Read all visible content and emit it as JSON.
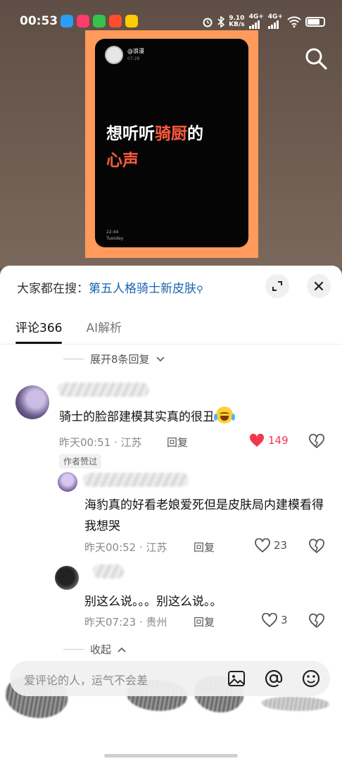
{
  "status_bar": {
    "time": "00:53",
    "net_speed": "9.10",
    "net_unit": "KB/s",
    "sim1": "4G+",
    "sim2": "4G+",
    "app_icon_colors": [
      "#2a9df4",
      "#ff3b6b",
      "#37c24b",
      "#ff4d2e",
      "#ffcc00"
    ]
  },
  "poster": {
    "handle": "@浪漫",
    "time": "07:28",
    "title_line1_a": "想听听",
    "title_line1_b": "骑厨",
    "title_line1_c": "的",
    "title_line2": "心声",
    "clock": "22:44",
    "day": "Tuesday",
    "bg_color": "#ff9a5a",
    "highlight_color": "#ff5a3c"
  },
  "sheet": {
    "hot_search_prefix": "大家都在搜：",
    "hot_search_query": "第五人格骑士新皮肤",
    "tabs": [
      {
        "label": "评论366",
        "active": true
      },
      {
        "label": "AI解析",
        "active": false
      }
    ],
    "expand_replies": "展开8条回复",
    "collapse": "收起"
  },
  "comments": [
    {
      "text": "骑士的脸部建模其实真的很丑",
      "time": "昨天00:51",
      "location": "江苏",
      "reply": "回复",
      "likes": "149",
      "liked": true
    }
  ],
  "replies": [
    {
      "badge": "作者赞过",
      "text": "海豹真的好看老娘爱死但是皮肤局内建模看得我想哭",
      "time": "昨天00:52",
      "location": "江苏",
      "reply": "回复",
      "likes": "23"
    },
    {
      "text": "别这么说。。。别这么说。。",
      "time": "昨天07:23",
      "location": "贵州",
      "reply": "回复",
      "likes": "3"
    }
  ],
  "input_bar": {
    "placeholder": "爱评论的人，运气不会差"
  },
  "colors": {
    "like_red": "#f2374e",
    "link_blue": "#1a63b0"
  }
}
